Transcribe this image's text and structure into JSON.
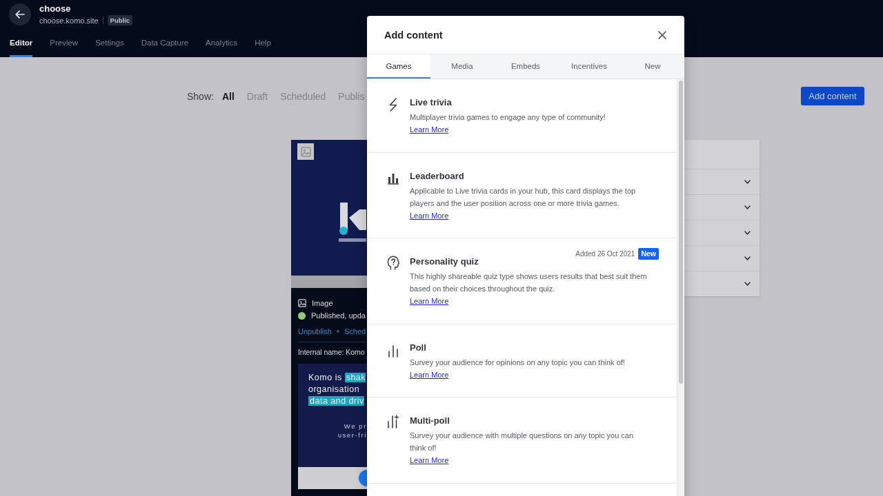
{
  "header": {
    "title": "choose",
    "url": "choose.komo.site",
    "visibility": "Public",
    "tabs": [
      {
        "label": "Editor",
        "selected": true
      },
      {
        "label": "Preview",
        "selected": false
      },
      {
        "label": "Settings",
        "selected": false
      },
      {
        "label": "Data Capture",
        "selected": false
      },
      {
        "label": "Analytics",
        "selected": false
      },
      {
        "label": "Help",
        "selected": false
      }
    ]
  },
  "toolbar": {
    "show_label": "Show:",
    "filters": [
      {
        "label": "All",
        "selected": true
      },
      {
        "label": "Draft",
        "selected": false
      },
      {
        "label": "Scheduled",
        "selected": false
      },
      {
        "label": "Publis",
        "selected": false
      }
    ],
    "add_button": "Add content"
  },
  "card": {
    "type": "Image",
    "status": {
      "text": "Published, upda",
      "color": "#94c97a"
    },
    "actions": [
      "Unpublish",
      "Sched"
    ],
    "internal_name": "Internal name: Komo",
    "preview": {
      "heading_lines": [
        [
          {
            "text": "Komo is ",
            "highlight": false
          },
          {
            "text": "shak",
            "highlight": true
          }
        ],
        [
          {
            "text": "organisation",
            "highlight": false
          }
        ],
        [
          {
            "text": "data and driv",
            "highlight": true
          }
        ]
      ],
      "body_lines": [
        "We pr",
        "user-fri"
      ]
    }
  },
  "settings_panel": {
    "sections": [
      {
        "expanded": false
      },
      {
        "expanded": false
      },
      {
        "expanded": false
      },
      {
        "expanded": false
      },
      {
        "expanded": false
      }
    ]
  },
  "modal": {
    "title": "Add content",
    "tabs": [
      {
        "label": "Games",
        "selected": true
      },
      {
        "label": "Media",
        "selected": false
      },
      {
        "label": "Embeds",
        "selected": false
      },
      {
        "label": "Incentives",
        "selected": false
      },
      {
        "label": "New",
        "selected": false
      }
    ],
    "items": [
      {
        "title": "Live trivia",
        "description": "Multiplayer trivia games to engage any type of community!",
        "link": "Learn More"
      },
      {
        "title": "Leaderboard",
        "description": "Applicable to Live trivia cards in your hub, this card displays the top players and the user position across one or more trivia games.",
        "link": "Learn More"
      },
      {
        "title": "Personality quiz",
        "description": "This highly shareable quiz type shows users results that best suit them based on their choices throughout the quiz.",
        "link": "Learn More",
        "added": "Added 26 Oct 2021",
        "badge": "New"
      },
      {
        "title": "Poll",
        "description": "Survey your audience for opinions on any topic you can think of!",
        "link": "Learn More"
      },
      {
        "title": "Multi-poll",
        "description": "Survey your audience with multiple questions on any topic you can think of!",
        "link": "Learn More"
      }
    ]
  }
}
